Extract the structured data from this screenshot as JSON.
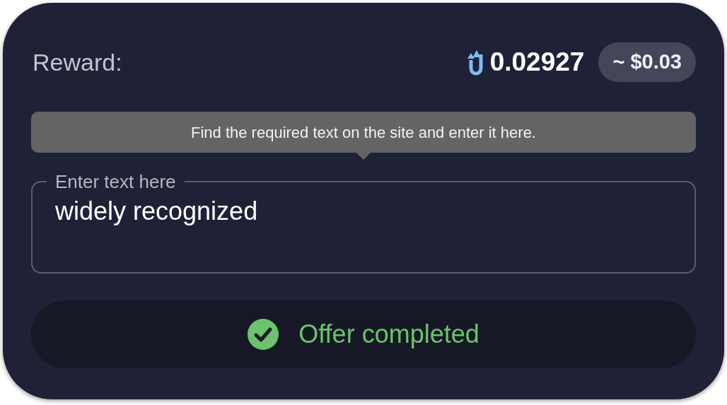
{
  "reward": {
    "label": "Reward:",
    "amount": "0.02927",
    "usd": "~ $0.03"
  },
  "tooltip": "Find the required text on the site and enter it here.",
  "field": {
    "label": "Enter text here",
    "value": "widely recognized"
  },
  "status": {
    "text": "Offer completed",
    "done": true
  }
}
